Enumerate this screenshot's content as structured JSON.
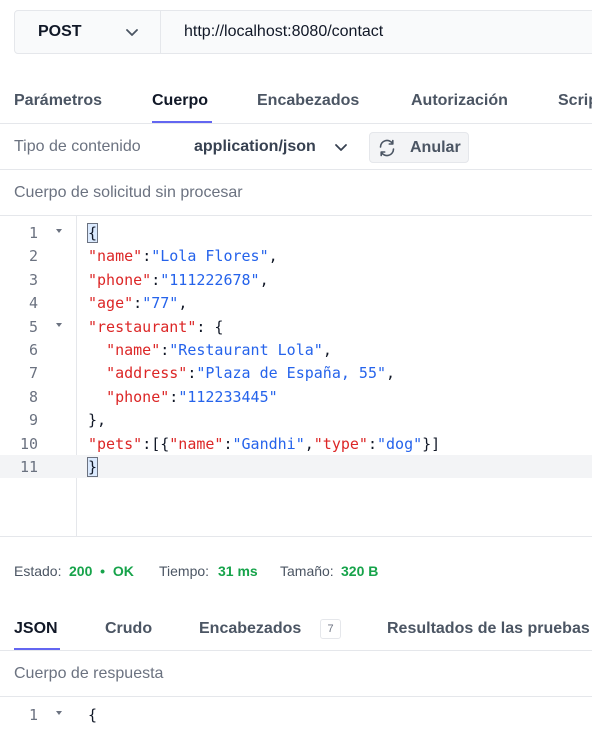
{
  "request": {
    "method": "POST",
    "url": "http://localhost:8080/contact"
  },
  "tabs": [
    {
      "label": "Parámetros",
      "active": false
    },
    {
      "label": "Cuerpo",
      "active": true
    },
    {
      "label": "Encabezados",
      "active": false
    },
    {
      "label": "Autorización",
      "active": false
    },
    {
      "label": "Scripts",
      "active": false
    }
  ],
  "content_type": {
    "label": "Tipo de contenido",
    "value": "application/json",
    "override_label": "Anular",
    "override_icon": "refresh-icon"
  },
  "body": {
    "label": "Cuerpo de solicitud sin procesar",
    "line_numbers": [
      "1",
      "2",
      "3",
      "4",
      "5",
      "6",
      "7",
      "8",
      "9",
      "10",
      "11"
    ]
  },
  "status": {
    "estado_label": "Estado:",
    "estado_value": "200  •  OK",
    "tiempo_label": "Tiempo:",
    "tiempo_value": "31 ms",
    "tamano_label": "Tamaño:",
    "tamano_value": "320 B"
  },
  "response_tabs": [
    {
      "label": "JSON",
      "active": true
    },
    {
      "label": "Crudo",
      "active": false
    },
    {
      "label": "Encabezados",
      "active": false,
      "badge": "7"
    },
    {
      "label": "Resultados de las pruebas",
      "active": false
    }
  ],
  "response": {
    "label": "Cuerpo de respuesta",
    "line_number": "1",
    "first_line": "{"
  },
  "colors": {
    "accent": "#6366f1",
    "key": "#dc2626",
    "string": "#2563eb",
    "success": "#16a34a"
  }
}
